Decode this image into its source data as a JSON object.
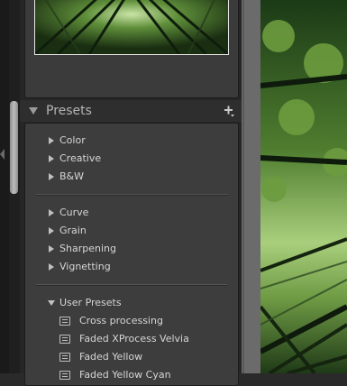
{
  "presets_panel": {
    "title": "Presets",
    "groups_1": [
      "Color",
      "Creative",
      "B&W"
    ],
    "groups_2": [
      "Curve",
      "Grain",
      "Sharpening",
      "Vignetting"
    ],
    "user_presets": {
      "title": "User Presets",
      "items": [
        "Cross processing",
        "Faded XProcess Velvia",
        "Faded Yellow",
        "Faded Yellow Cyan"
      ]
    }
  },
  "icons": {
    "add": "plus-icon",
    "collapse": "triangle-down-icon",
    "expand": "triangle-right-icon",
    "preset": "preset-doc-icon"
  },
  "colors": {
    "panel_bg": "#3d3d3d",
    "text": "#d6d6d6",
    "header_text": "#b4b4b4"
  }
}
